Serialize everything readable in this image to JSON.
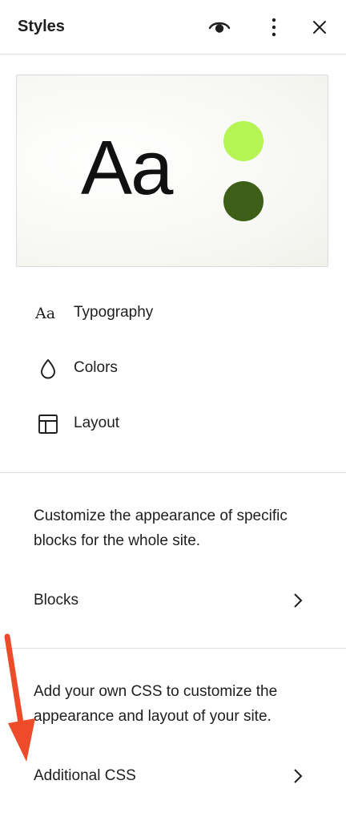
{
  "header": {
    "title": "Styles",
    "icons": [
      "eye-icon",
      "more-vertical-icon",
      "close-icon"
    ]
  },
  "preview": {
    "sample_text": "Aa",
    "colors": [
      "#b5f553",
      "#3d5f17"
    ]
  },
  "nav": {
    "items": [
      {
        "label": "Typography",
        "icon": "typography-icon"
      },
      {
        "label": "Colors",
        "icon": "droplet-icon"
      },
      {
        "label": "Layout",
        "icon": "layout-icon"
      }
    ]
  },
  "blocks_section": {
    "description": "Customize the appearance of specific blocks for the whole site.",
    "label": "Blocks"
  },
  "css_section": {
    "description": "Add your own CSS to customize the appearance and layout of your site.",
    "label": "Additional CSS"
  },
  "annotation": {
    "arrow_color": "#ee4b2b"
  }
}
